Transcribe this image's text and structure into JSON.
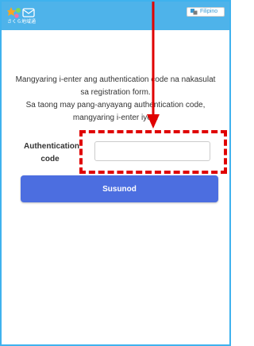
{
  "header": {
    "logo_text": "さくら地域通",
    "language_label": "Filipino",
    "language_icon": "translate-icon"
  },
  "instructions": {
    "line1": "Mangyaring i-enter ang authentication code na nakasulat sa registration form.",
    "line2": "Sa taong may pang-anyayang authentication code, mangyaring i-enter iyon."
  },
  "form": {
    "code_label": "Authentication code",
    "code_value": "",
    "code_placeholder": ""
  },
  "actions": {
    "next_label": "Susunod"
  },
  "annotation": {
    "color": "#e00000",
    "arrow_icon": "down-arrow-icon"
  },
  "colors": {
    "header": "#4eb3ea",
    "button": "#4c6ee0",
    "frame": "#3fb2ee"
  }
}
